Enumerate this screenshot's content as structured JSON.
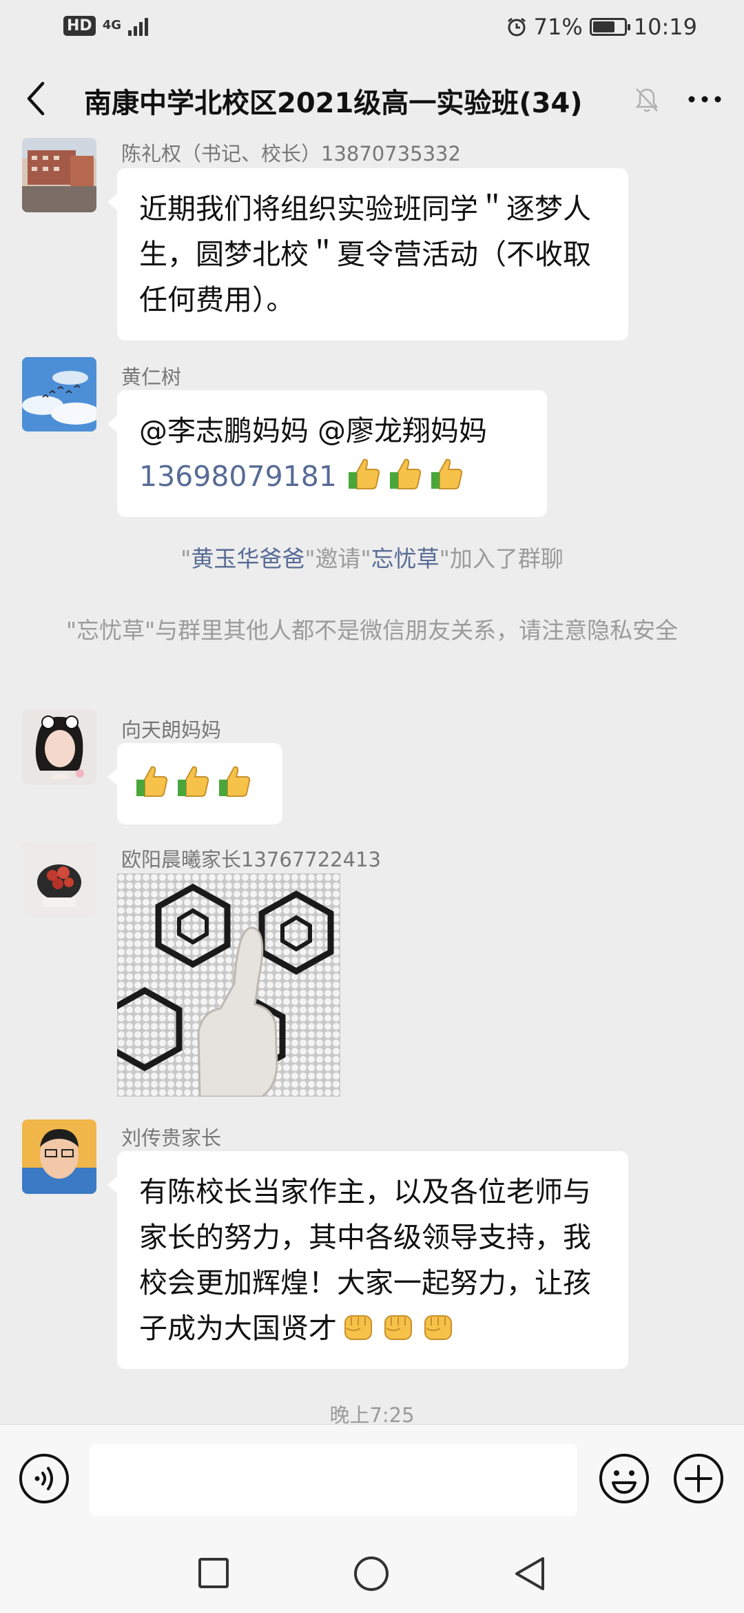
{
  "status_bar": {
    "hd_label": "HD",
    "network_label": "4G",
    "battery_text": "71%",
    "battery_level": 0.71,
    "time": "10:19"
  },
  "nav": {
    "title": "南康中学北校区2021级高一实验班(34)",
    "icons": [
      "back-icon",
      "mute-icon",
      "more-icon"
    ]
  },
  "messages": [
    {
      "sender": "陈礼权（书记、校长）13870735332",
      "text": "近期我们将组织实验班同学＂逐梦人生，圆梦北校＂夏令营活动（不收取任何费用）。"
    },
    {
      "sender": "黄仁树",
      "mentions": "@李志鹏妈妈 @廖龙翔妈妈",
      "phone": "13698079181",
      "emoji": "thumbs-up x3"
    },
    {
      "sender": "向天朗妈妈",
      "emoji": "thumbs-up x3"
    },
    {
      "sender": "欧阳晨曦家长13767722413",
      "image": "thumbs-up-photo"
    },
    {
      "sender": "刘传贵家长",
      "text": "有陈校长当家作主，以及各位老师与家长的努力，其中各级领导支持，我校会更加辉煌！大家一起努力，让孩子成为大国贤才",
      "emoji": "fist x3"
    }
  ],
  "system_messages": {
    "invite": {
      "quote_open": "\"",
      "inviter": "黄玉华爸爸",
      "middle": "\"邀请\"",
      "invitee": "忘忧草",
      "suffix": "\"加入了群聊"
    },
    "privacy": "\"忘忧草\"与群里其他人都不是微信朋友关系，请注意隐私安全"
  },
  "time_label": "晚上7:25",
  "input_bar": {
    "input_value": "",
    "icons": [
      "voice-icon",
      "emoji-icon",
      "plus-icon"
    ]
  },
  "system_nav": {
    "icons": [
      "recents-icon",
      "home-icon",
      "back-triangle-icon"
    ]
  },
  "colors": {
    "background": "#ededed",
    "bubble": "#ffffff",
    "link": "#576b95",
    "system_text": "#9b9b9b"
  }
}
